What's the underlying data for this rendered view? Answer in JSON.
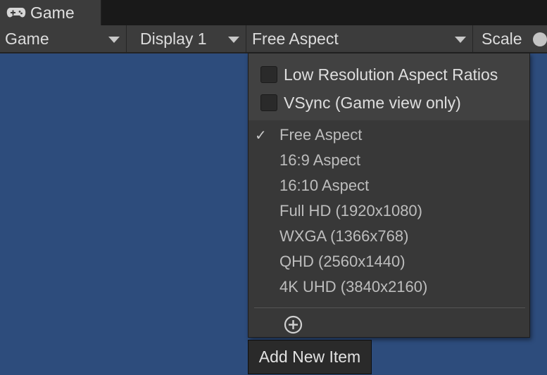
{
  "window": {
    "tab_label": "Game",
    "tab_icon": "gamepad-icon"
  },
  "toolbar": {
    "view_mode": "Game",
    "display": "Display 1",
    "aspect": "Free Aspect",
    "scale_label": "Scale"
  },
  "aspect_menu": {
    "options": [
      {
        "label": "Low Resolution Aspect Ratios",
        "checked": false
      },
      {
        "label": "VSync (Game view only)",
        "checked": false
      }
    ],
    "check_mark": "✓",
    "selected_index": 0,
    "items": [
      "Free Aspect",
      "16:9 Aspect",
      "16:10 Aspect",
      "Full HD (1920x1080)",
      "WXGA (1366x768)",
      "QHD (2560x1440)",
      "4K UHD (3840x2160)"
    ],
    "add_icon": "plus-circle-icon"
  },
  "tooltip": {
    "text": "Add New Item"
  },
  "colors": {
    "viewport": "#2d4c7c",
    "toolbar": "#3c3c3c",
    "popup": "#383838"
  }
}
